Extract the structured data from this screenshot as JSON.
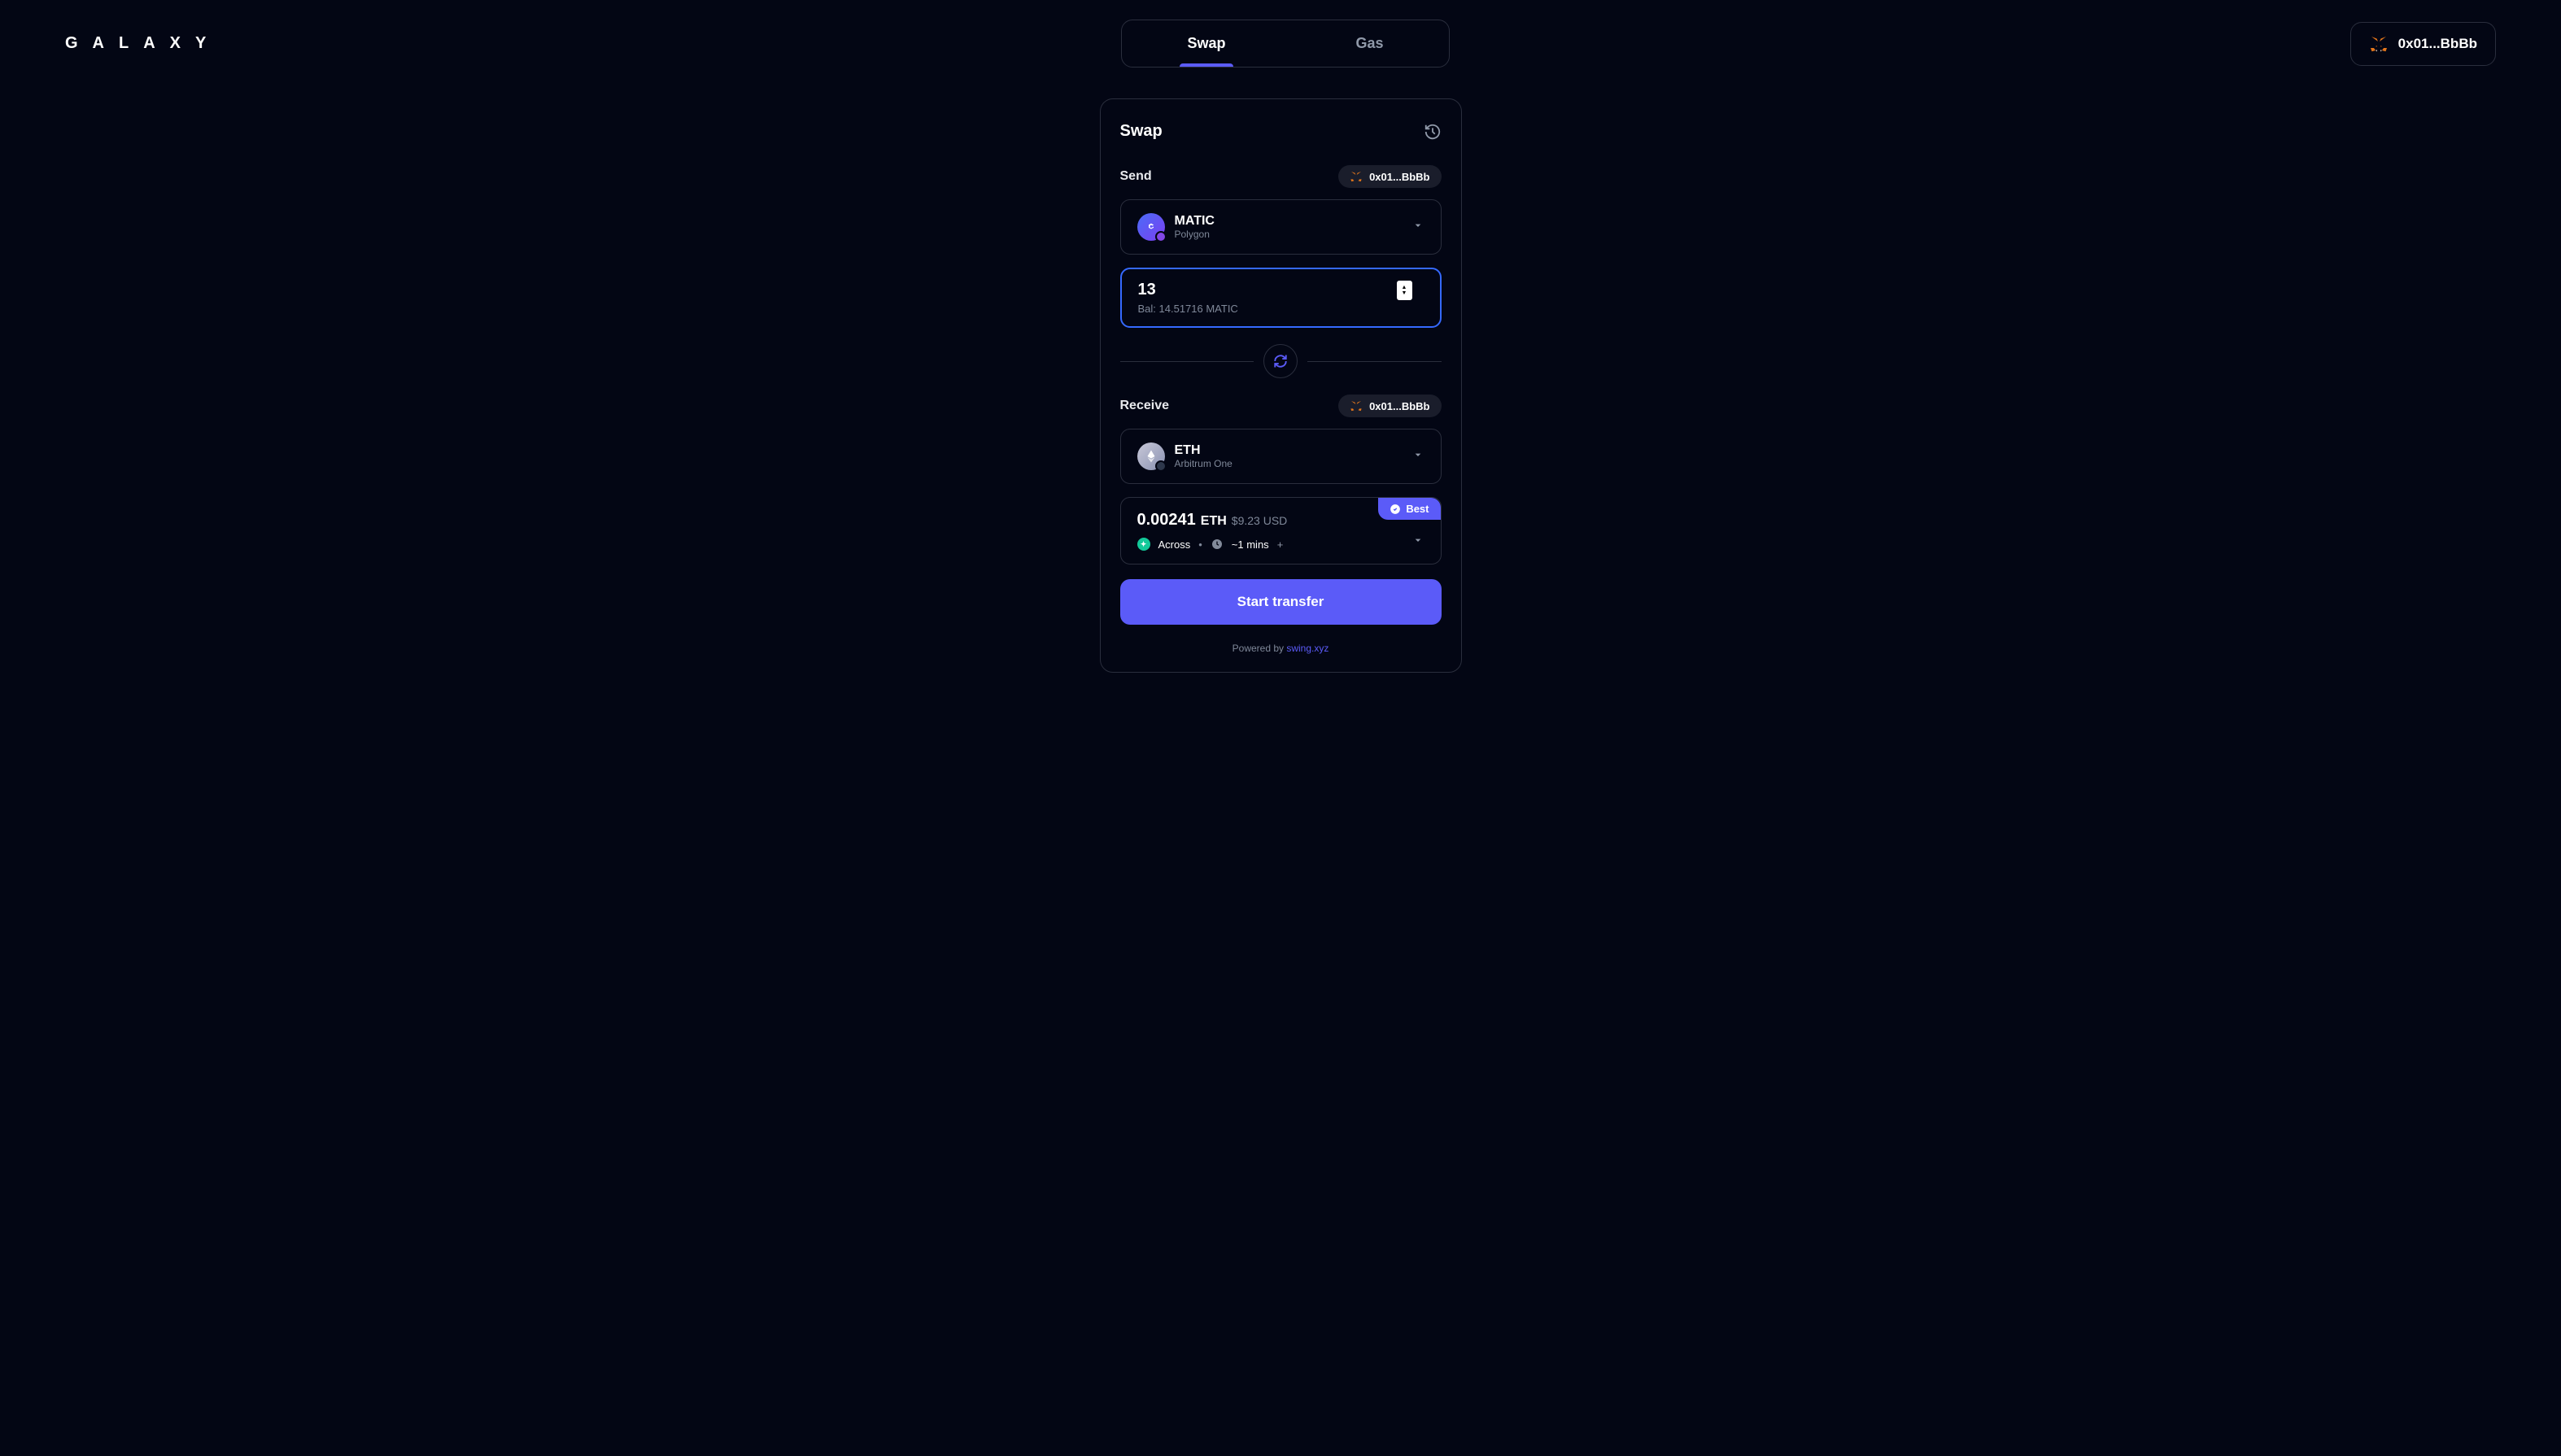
{
  "brand": "GALAXY",
  "topTabs": {
    "swap": "Swap",
    "gas": "Gas"
  },
  "wallet": {
    "address": "0x01...BbBb"
  },
  "card": {
    "title": "Swap",
    "send": {
      "label": "Send",
      "wallet": "0x01...BbBb",
      "token": {
        "symbol": "MATIC",
        "chain": "Polygon"
      },
      "amount": "13",
      "balance": "Bal: 14.51716 MATIC"
    },
    "receive": {
      "label": "Receive",
      "wallet": "0x01...BbBb",
      "token": {
        "symbol": "ETH",
        "chain": "Arbitrum One"
      }
    },
    "quote": {
      "amount": "0.00241",
      "symbol": "ETH",
      "usd": "$9.23 USD",
      "badge": "Best",
      "route": "Across",
      "time": "~1 mins",
      "plus": "+"
    },
    "cta": "Start transfer",
    "footer": {
      "prefix": "Powered by ",
      "link": "swing.xyz"
    }
  }
}
